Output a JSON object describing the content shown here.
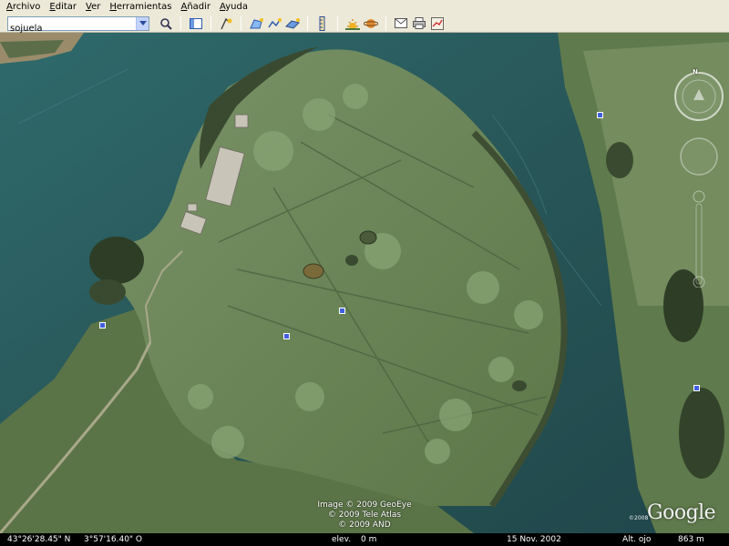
{
  "menu": [
    "Archivo",
    "Editar",
    "Ver",
    "Herramientas",
    "Añadir",
    "Ayuda"
  ],
  "search": {
    "value": "sojuela"
  },
  "toolbar_icons": [
    "search-icon",
    "sidebar-icon",
    "placemark-icon",
    "polygon-icon",
    "path-icon",
    "image-overlay-icon",
    "ruler-icon",
    "sun-icon",
    "planet-icon",
    "email-icon",
    "print-icon",
    "maps-icon"
  ],
  "credits": [
    "Image © 2009 GeoEye",
    "© 2009 Tele Atlas",
    "© 2009 AND"
  ],
  "logo": {
    "text": "Google",
    "year": "©2008"
  },
  "compass": {
    "north": "N"
  },
  "status": {
    "lat": "43°26'28.45\" N",
    "lon": "3°57'16.40\" O",
    "elev_label": "elev.",
    "elev_value": "0 m",
    "date": "15 Nov. 2002",
    "eye_label": "Alt. ojo",
    "eye_value": "863 m"
  },
  "colors": {
    "water": "#2b5a5e",
    "land": "#6e8a5a",
    "menu_bg": "#ece9d8",
    "status_bg": "#000000",
    "placemark": "#4060e0"
  }
}
